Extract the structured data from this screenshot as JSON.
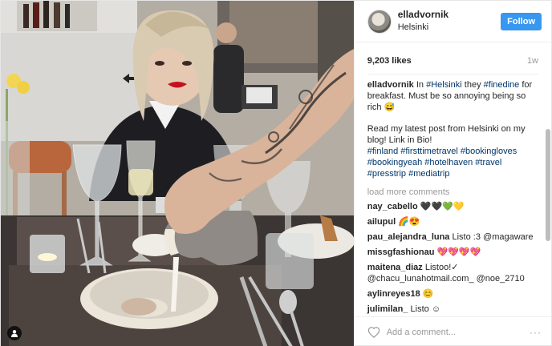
{
  "header": {
    "username": "elladvornik",
    "location": "Helsinki",
    "follow_label": "Follow"
  },
  "stats": {
    "likes": "9,203 likes",
    "time_ago": "1w"
  },
  "caption": {
    "author": "elladvornik",
    "line1_before": "In ",
    "tag_helsinki": "#Helsinki",
    "line1_mid": " they ",
    "tag_finedine": "#finedine",
    "line1_after": " for breakfast. Must be so annoying being so rich 😅",
    "line2": "Read my latest post from Helsinki on my blog! Link in Bio!",
    "hashtags": "#finland #firsttimetravel #bookingloves #bookingyeah #hotelhaven #travel #presstrip #mediatrip"
  },
  "load_more": "load more comments",
  "comments": [
    {
      "user": "nay_cabello",
      "text": "🖤🖤💚💛"
    },
    {
      "user": "ailupul",
      "text": "🌈😍"
    },
    {
      "user": "pau_alejandra_luna",
      "text": "Listo :3 @magaware"
    },
    {
      "user": "missgfashionau",
      "text": "💖💖💖💖"
    },
    {
      "user": "maitena_diaz",
      "text": "Listoo!✓ @chacu_lunahotmail.com_ @noe_2710"
    },
    {
      "user": "aylinreyes18",
      "text": "😊"
    },
    {
      "user": "julimilan_",
      "text": "Listo ☺"
    }
  ],
  "add_comment_placeholder": "Add a comment...",
  "more_options": "···",
  "colors": {
    "accent": "#3897f0",
    "hashtag": "#003569",
    "lipstick": "#c1121f"
  },
  "icons": [
    "heart-icon",
    "user-tag-icon",
    "more-options-icon"
  ]
}
